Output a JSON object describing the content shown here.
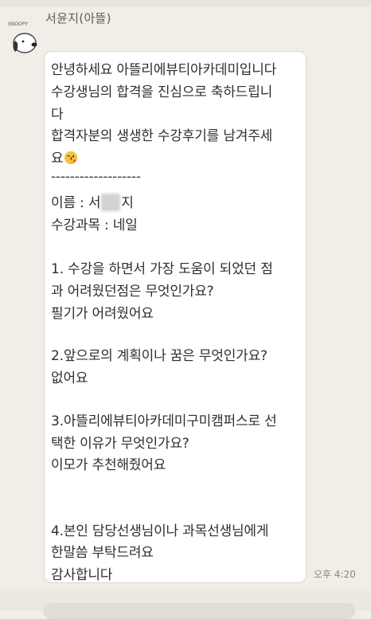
{
  "chat": {
    "sender_name": "서윤지(아뜰)",
    "avatar_badge": "SNOOPY",
    "time": "오후 4:20",
    "message_lines": [
      "안녕하세요 아뜰리에뷰티아카데미입니다",
      "수강생님의 합격을 진심으로 축하드립니",
      "다",
      "합격자분의 생생한 수강후기를 남겨주세",
      "요",
      "-------------------",
      "이름 : 서",
      "지",
      "수강과목 : 네일",
      "1. 수강을 하면서 가장 도움이 되었던 점",
      "과 어려웠던점은 무엇인가요?",
      "필기가 어려웠어요",
      "2.앞으로의 계획이나 꿈은 무엇인가요?",
      "없어요",
      "3.아뜰리에뷰티아카데미구미캠퍼스로 선",
      "택한 이유가 무엇인가요?",
      "이모가 추천해줬어요",
      "4.본인 담당선생님이나 과목선생님에게",
      "한말씀 부탁드려요",
      "감사합니다"
    ]
  },
  "icons": {
    "avatar": "snoopy-avatar-icon",
    "emoji": "kissing-face-emoji-icon"
  },
  "colors": {
    "background": "#f1ede7",
    "bubble": "#ffffff",
    "text": "#2e2e2e",
    "secondary_text": "#8a8783"
  }
}
